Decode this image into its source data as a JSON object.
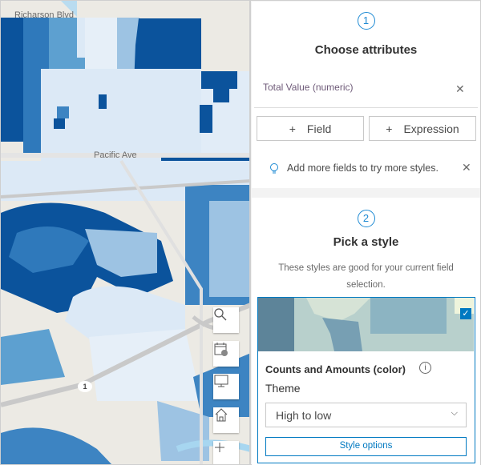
{
  "map": {
    "labels": {
      "street1": "Richarson Blvd",
      "street2": "Pacific Ave",
      "route": "1"
    },
    "controls": [
      {
        "icon": "search-icon"
      },
      {
        "icon": "basemap-calendar-icon"
      },
      {
        "icon": "monitor-icon"
      },
      {
        "icon": "home-icon"
      },
      {
        "icon": "zoom-in-icon"
      }
    ],
    "colors": {
      "dark": "#0b539c",
      "mid": "#3d84c2",
      "light": "#9dc3e3",
      "pale": "#dce9f6"
    }
  },
  "panel": {
    "step1": {
      "number": "1",
      "title": "Choose attributes",
      "field": "Total Value (numeric)",
      "add_field": "Field",
      "add_expression": "Expression",
      "tip": "Add more fields to try more styles."
    },
    "step2": {
      "number": "2",
      "title": "Pick a style",
      "description": "These styles are good for your current field selection.",
      "card": {
        "title": "Counts and Amounts (color)",
        "selected": true,
        "theme_label": "Theme",
        "theme_value": "High to low",
        "options_button": "Style options"
      }
    }
  },
  "colors": {
    "accent": "#0079c1"
  }
}
